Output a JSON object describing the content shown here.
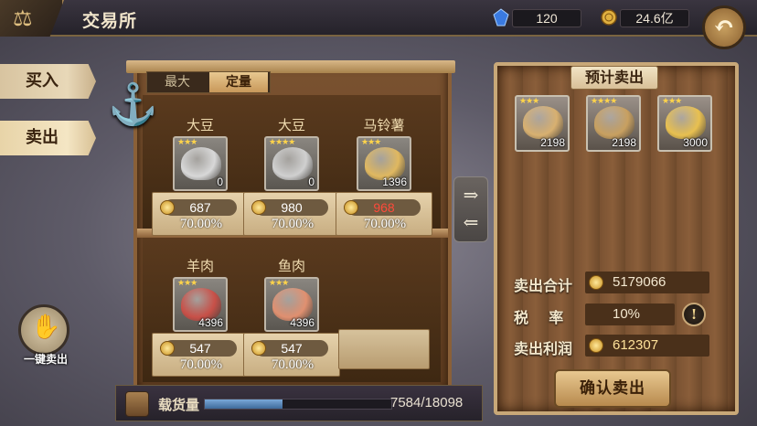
{
  "header": {
    "title": "交易所",
    "gems": "120",
    "gold": "24.6亿",
    "back_icon": "back-arrow-icon"
  },
  "sidebar": {
    "buy_label": "买入",
    "sell_label": "卖出",
    "quick_sell_label": "一键卖出"
  },
  "filter": {
    "max_label": "最大",
    "fixed_label": "定量"
  },
  "shelf_items": [
    {
      "name": "大豆",
      "stars": "★★★",
      "qty": "0",
      "price": "687",
      "pct": "70.00%",
      "art": "#d8d8d8"
    },
    {
      "name": "大豆",
      "stars": "★★★★",
      "qty": "0",
      "price": "980",
      "pct": "70.00%",
      "art": "#d0d0d0"
    },
    {
      "name": "马铃薯",
      "stars": "★★★",
      "qty": "1396",
      "price": "968",
      "pct": "70.00%",
      "art": "#e0b860"
    },
    {
      "name": "羊肉",
      "stars": "★★★",
      "qty": "4396",
      "price": "547",
      "pct": "70.00%",
      "art": "#c85048"
    },
    {
      "name": "鱼肉",
      "stars": "★★★",
      "qty": "4396",
      "price": "547",
      "pct": "70.00%",
      "art": "#e09070"
    }
  ],
  "cargo": {
    "label": "载货量",
    "value": "7584/18098",
    "fill_fraction": 0.419
  },
  "panel": {
    "header": "预计卖出",
    "previews": [
      {
        "stars": "★★★",
        "qty": "2198",
        "art": "#d8b070"
      },
      {
        "stars": "★★★★",
        "qty": "2198",
        "art": "#c8a060"
      },
      {
        "stars": "★★★",
        "qty": "3000",
        "art": "#e8c050"
      }
    ],
    "total_label": "卖出合计",
    "total_value": "5179066",
    "tax_label": "税    率",
    "tax_value": "10%",
    "profit_label": "卖出利润",
    "profit_value": "612307",
    "confirm_label": "确认卖出"
  }
}
